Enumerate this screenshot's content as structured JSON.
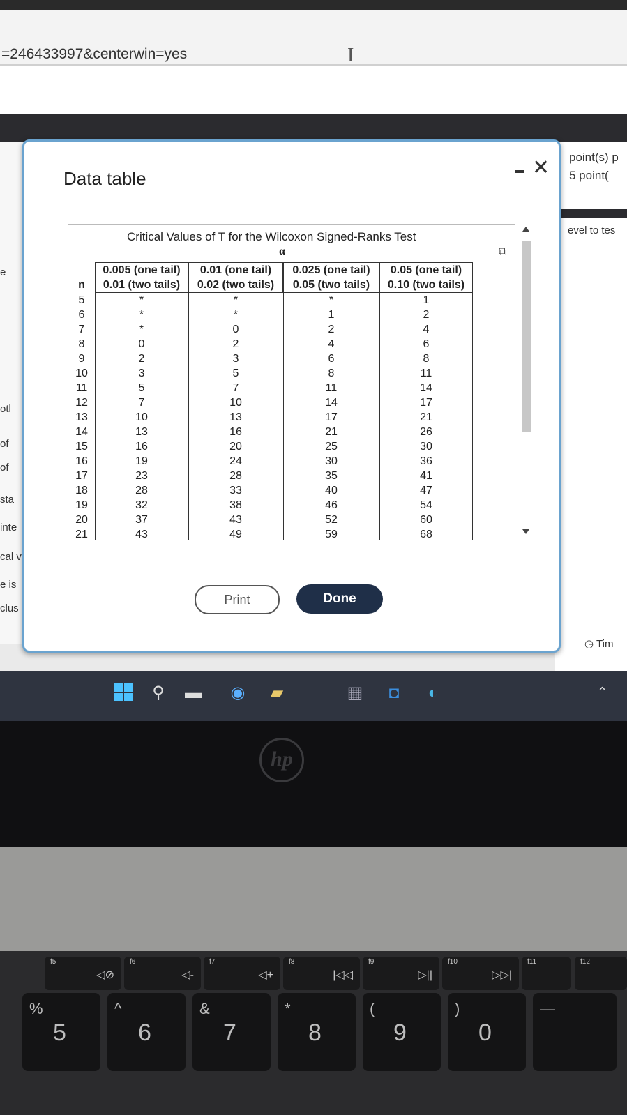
{
  "browser": {
    "url_fragment": "=246433997&centerwin=yes"
  },
  "background": {
    "right_texts": [
      "point(s) p",
      "5 point(",
      "evel to tes"
    ],
    "left_texts": [
      "e",
      "otl",
      "of",
      "of",
      "sta",
      "inte",
      "cal v",
      "e is",
      "clus"
    ],
    "timer_label": "Tim"
  },
  "dialog": {
    "title": "Data table",
    "minimize_label": "minimize",
    "close_label": "✕",
    "table": {
      "caption": "Critical Values of T for the Wilcoxon Signed-Ranks Test",
      "alpha_symbol": "α",
      "n_header": "n",
      "columns": [
        {
          "line1": "0.005 (one tail)",
          "line2": "0.01 (two tails)"
        },
        {
          "line1": "0.01 (one tail)",
          "line2": "0.02 (two tails)"
        },
        {
          "line1": "0.025 (one tail)",
          "line2": "0.05 (two tails)"
        },
        {
          "line1": "0.05 (one tail)",
          "line2": "0.10 (two tails)"
        }
      ],
      "rows": [
        [
          "5",
          "*",
          "*",
          "*",
          "1"
        ],
        [
          "6",
          "*",
          "*",
          "1",
          "2"
        ],
        [
          "7",
          "*",
          "0",
          "2",
          "4"
        ],
        [
          "8",
          "0",
          "2",
          "4",
          "6"
        ],
        [
          "9",
          "2",
          "3",
          "6",
          "8"
        ],
        [
          "10",
          "3",
          "5",
          "8",
          "11"
        ],
        [
          "11",
          "5",
          "7",
          "11",
          "14"
        ],
        [
          "12",
          "7",
          "10",
          "14",
          "17"
        ],
        [
          "13",
          "10",
          "13",
          "17",
          "21"
        ],
        [
          "14",
          "13",
          "16",
          "21",
          "26"
        ],
        [
          "15",
          "16",
          "20",
          "25",
          "30"
        ],
        [
          "16",
          "19",
          "24",
          "30",
          "36"
        ],
        [
          "17",
          "23",
          "28",
          "35",
          "41"
        ],
        [
          "18",
          "28",
          "33",
          "40",
          "47"
        ],
        [
          "19",
          "32",
          "38",
          "46",
          "54"
        ],
        [
          "20",
          "37",
          "43",
          "52",
          "60"
        ],
        [
          "21",
          "43",
          "49",
          "59",
          "68"
        ]
      ]
    },
    "print_label": "Print",
    "done_label": "Done"
  },
  "taskbar": {
    "icons": [
      "windows-start-icon",
      "search-icon",
      "file-explorer-icon",
      "chrome-icon",
      "folder-icon",
      "calculator-icon",
      "outlook-icon",
      "edge-icon"
    ]
  },
  "keyboard": {
    "fkeys": [
      {
        "fn": "f5",
        "label": "◁⊘"
      },
      {
        "fn": "f6",
        "label": "◁-"
      },
      {
        "fn": "f7",
        "label": "◁+"
      },
      {
        "fn": "f8",
        "label": "|◁◁"
      },
      {
        "fn": "f9",
        "label": "▷||"
      },
      {
        "fn": "f10",
        "label": "▷▷|"
      },
      {
        "fn": "f11",
        "label": ""
      },
      {
        "fn": "f12",
        "label": ""
      }
    ],
    "keys": [
      {
        "sym": "%",
        "num": "5"
      },
      {
        "sym": "^",
        "num": "6"
      },
      {
        "sym": "&",
        "num": "7"
      },
      {
        "sym": "*",
        "num": "8"
      },
      {
        "sym": "(",
        "num": "9"
      },
      {
        "sym": ")",
        "num": "0"
      },
      {
        "sym": "—",
        "num": ""
      }
    ]
  }
}
